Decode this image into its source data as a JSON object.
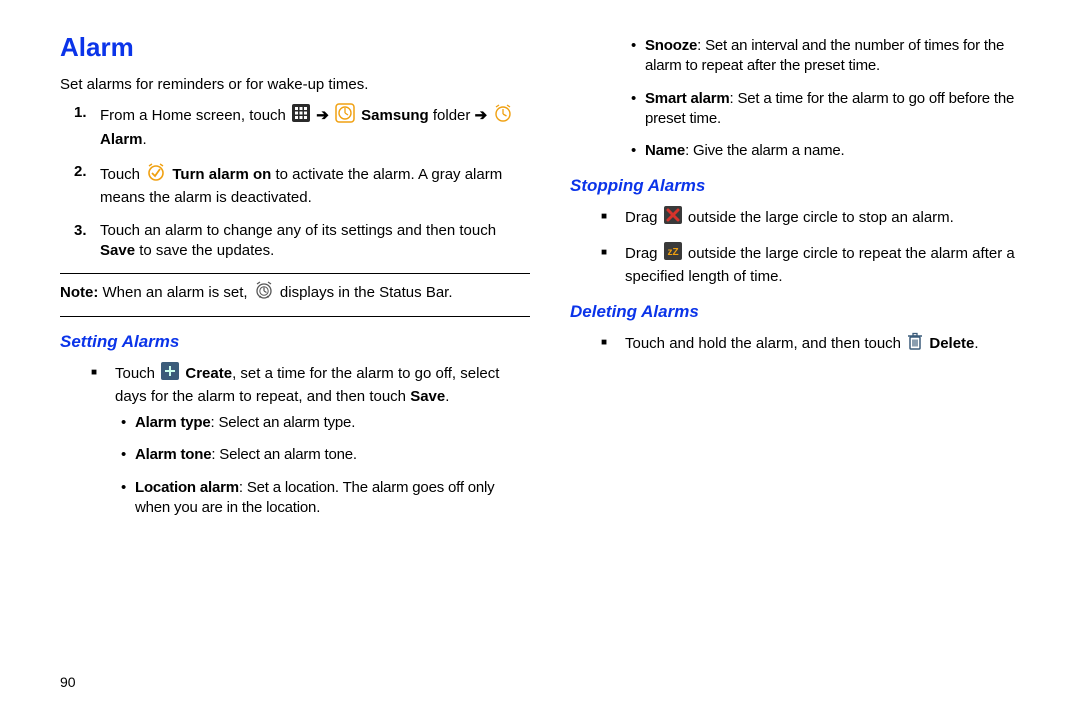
{
  "headings": {
    "alarm": "Alarm",
    "setting_alarms": "Setting Alarms",
    "stopping_alarms": "Stopping Alarms",
    "deleting_alarms": "Deleting Alarms"
  },
  "intro": "Set alarms for reminders or for wake-up times.",
  "steps": {
    "s1_a": "From a Home screen, touch ",
    "s1_b": " Samsung",
    "s1_c": " folder ",
    "s1_d": " Alarm",
    "s1_dot": ".",
    "s2_a": "Touch ",
    "s2_b": " Turn alarm on",
    "s2_c": " to activate the alarm. A gray alarm means the alarm is deactivated.",
    "s3_a": "Touch an alarm to change any of its settings and then touch ",
    "s3_b": "Save",
    "s3_c": " to save the updates."
  },
  "note": {
    "label": "Note:",
    "a": " When an alarm is set, ",
    "b": " displays in the Status Bar."
  },
  "setting": {
    "a1": "Touch ",
    "a2": " Create",
    "a3": ", set a time for the alarm to go off, select days for the alarm to repeat, and then touch ",
    "a4": "Save",
    "a5": ".",
    "b1_label": "Alarm type",
    "b1_text": ": Select an alarm type.",
    "b2_label": "Alarm tone",
    "b2_text": ": Select an alarm tone.",
    "b3_label": "Location alarm",
    "b3_text": ": Set a location. The alarm goes off only when you are in the location.",
    "b4_label": "Snooze",
    "b4_text": ": Set an interval and the number of times for the alarm to repeat after the preset time.",
    "b5_label": "Smart alarm",
    "b5_text": ": Set a time for the alarm to go off before the preset time.",
    "b6_label": "Name",
    "b6_text": ": Give the alarm a name."
  },
  "stopping": {
    "a1": "Drag ",
    "a2": " outside the large circle to stop an alarm.",
    "b1": "Drag ",
    "b2": " outside the large circle to repeat the alarm after a specified length of time."
  },
  "deleting": {
    "a1": "Touch and hold the alarm, and then touch ",
    "a2": " Delete",
    "a3": "."
  },
  "page_number": "90"
}
